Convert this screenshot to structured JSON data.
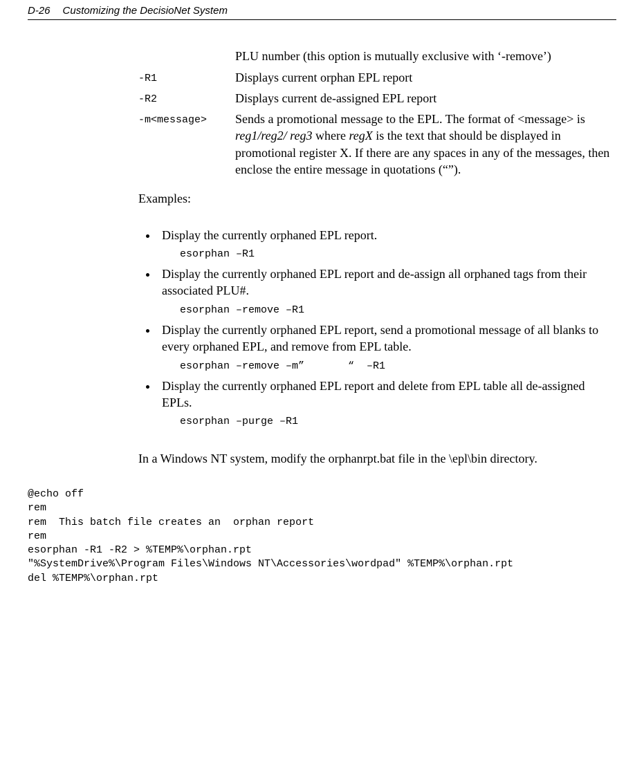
{
  "header": {
    "page_num": "D-26",
    "title": "Customizing the DecisioNet System"
  },
  "intro_cont": "PLU number (this option is mutually exclusive with ‘-remove’)",
  "options": [
    {
      "key": "-R1",
      "val": "Displays current orphan EPL report"
    },
    {
      "key": "-R2",
      "val": "Displays current de-assigned EPL report"
    },
    {
      "key": "-m<message>",
      "val_pre": "Sends a promotional message to the EPL. The format of <message> is ",
      "val_italic1": "reg1/reg2/ reg3",
      "val_mid": " where ",
      "val_italic2": "regX ",
      "val_post": " is the text that should be displayed in promotional register X. If there are any spaces in any of the messages, then enclose the entire message in quotations (“”)."
    }
  ],
  "examples_label": "Examples:",
  "examples": [
    {
      "text": "Display the currently orphaned EPL report.",
      "cmd": "esorphan –R1"
    },
    {
      "text": "Display the currently orphaned EPL report and de-assign all orphaned tags from their associated PLU#.",
      "cmd": "esorphan –remove –R1"
    },
    {
      "text": "Display the currently orphaned EPL report, send a promotional message of all blanks to every orphaned EPL, and remove from EPL table.",
      "cmd": "esorphan –remove –m”       “  –R1"
    },
    {
      "text": "Display the currently orphaned EPL report and delete from EPL table all de-assigned EPLs.",
      "cmd": "esorphan –purge –R1"
    }
  ],
  "after_note": "In a Windows NT system, modify the orphanrpt.bat file in the \\epl\\bin directory.",
  "batch": "@echo off\nrem\nrem  This batch file creates an  orphan report\nrem\nesorphan -R1 -R2 > %TEMP%\\orphan.rpt\n\"%SystemDrive%\\Program Files\\Windows NT\\Accessories\\wordpad\" %TEMP%\\orphan.rpt\ndel %TEMP%\\orphan.rpt"
}
